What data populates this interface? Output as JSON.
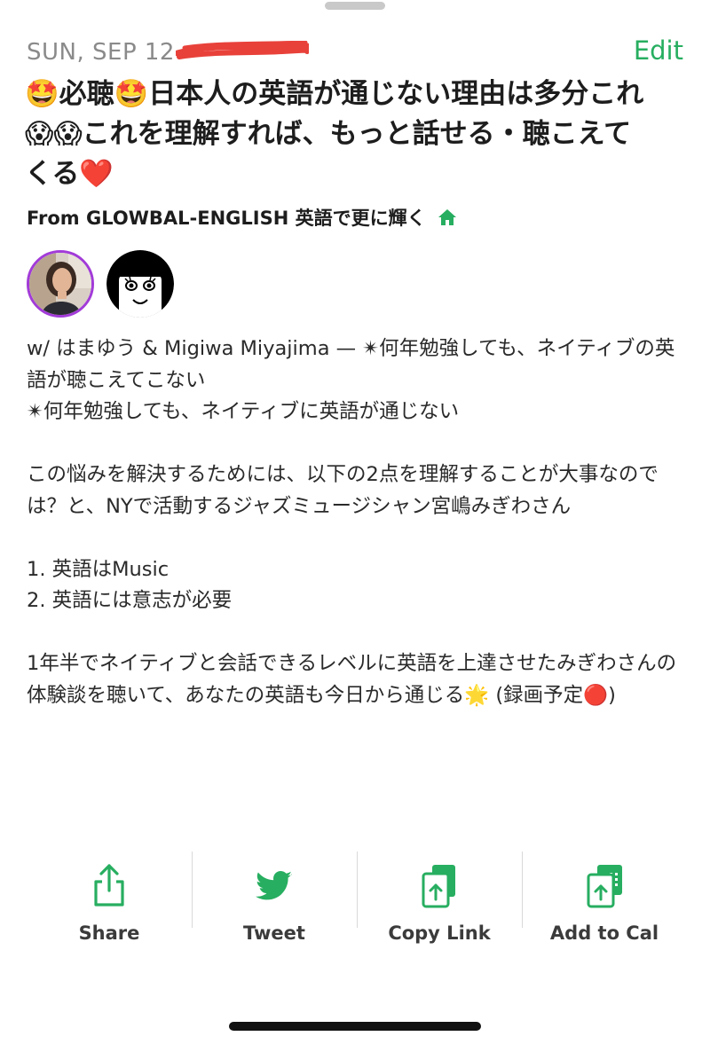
{
  "event": {
    "date": "SUN, SEP 12",
    "edit_label": "Edit",
    "title": "🤩必聴🤩日本人の英語が通じない理由は多分これ😱😱これを理解すれば、もっと話せる・聴こえてくる❤️",
    "from_label": "From GLOWBAL-ENGLISH 英語で更に輝く",
    "description": "w/ はまゆう & Migiwa Miyajima — ✴︎何年勉強しても、ネイティブの英語が聴こえてこない\n✴︎何年勉強しても、ネイティブに英語が通じない\n\nこの悩みを解決するためには、以下の2点を理解することが大事なのでは？と、NYで活動するジャズミュージシャン宮嶋みぎわさん\n\n1. 英語はMusic\n2. 英語には意志が必要\n\n1年半でネイティブと会話できるレベルに英語を上達させたみぎわさんの体験談を聴いて、あなたの英語も今日から通じる🌟 (録画予定🔴)"
  },
  "hosts": [
    {
      "avatar": "photo-avatar"
    },
    {
      "avatar": "cartoon-avatar"
    }
  ],
  "actions": [
    {
      "label": "Share",
      "icon": "share-icon"
    },
    {
      "label": "Tweet",
      "icon": "twitter-bird-icon"
    },
    {
      "label": "Copy Link",
      "icon": "copy-link-icon"
    },
    {
      "label": "Add to Cal",
      "icon": "calendar-add-icon"
    }
  ],
  "colors": {
    "accent": "#27ae60",
    "avatar_ring": "#a23bd8",
    "redaction": "#e8413a"
  }
}
